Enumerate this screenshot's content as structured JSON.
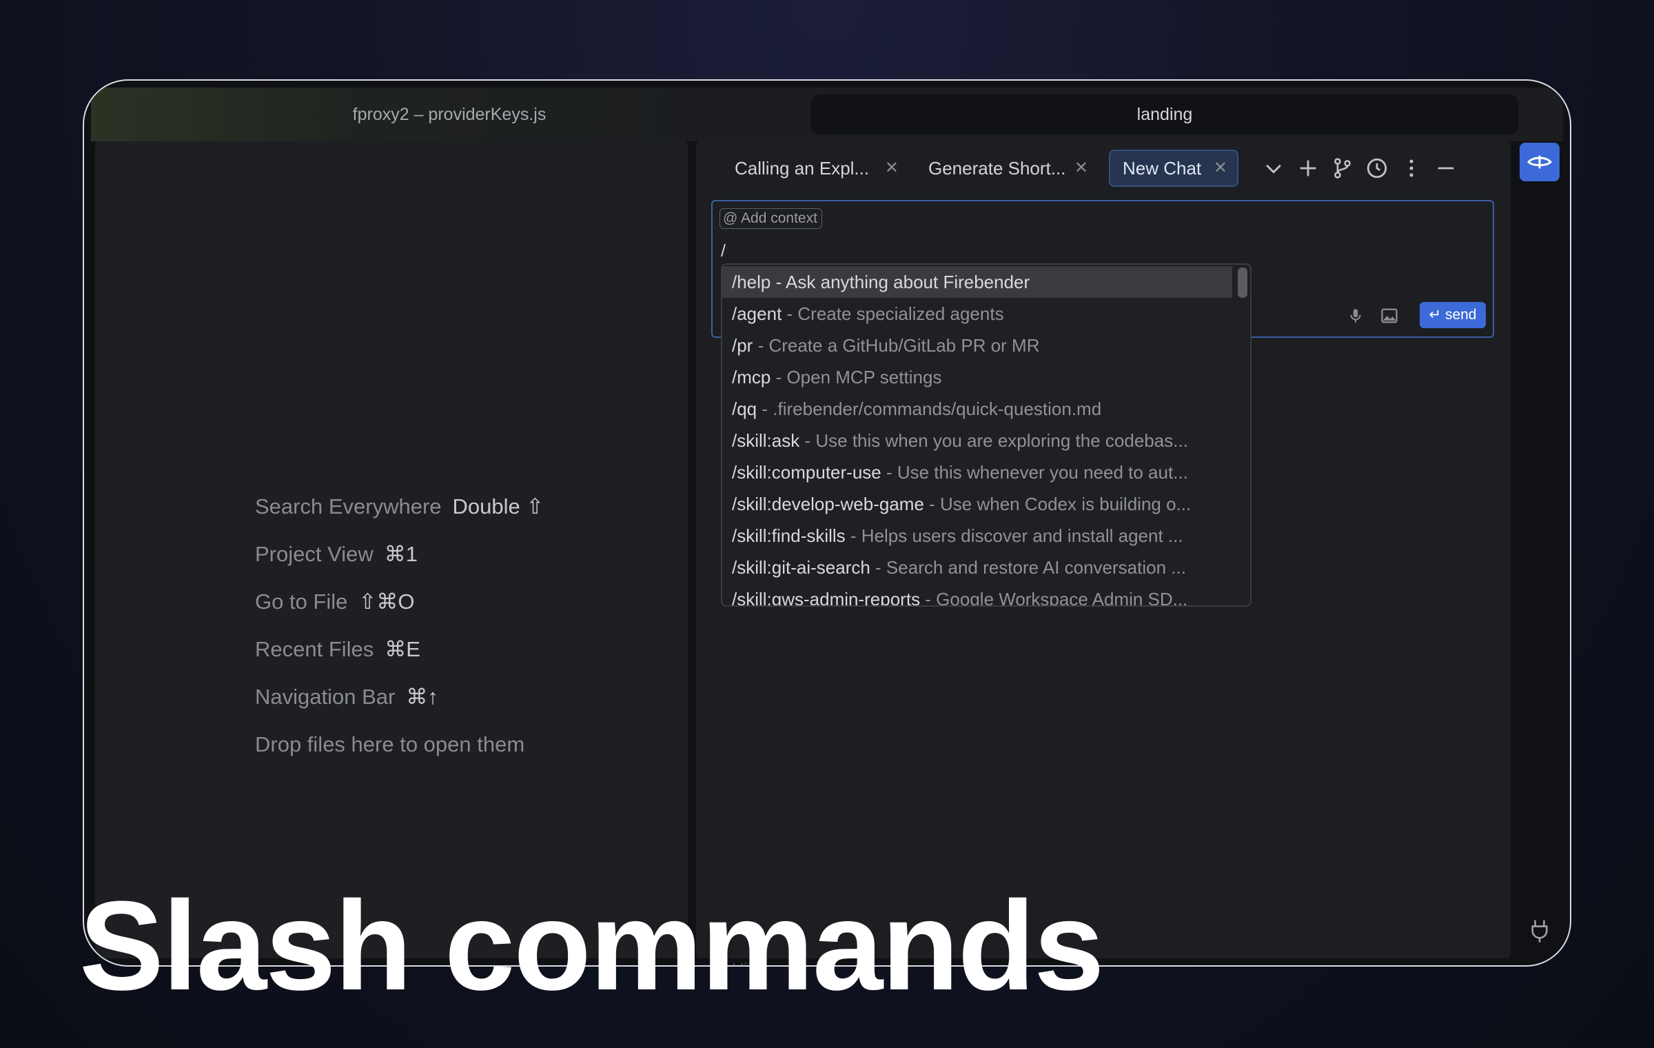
{
  "window": {
    "left_title": "fproxy2 – providerKeys.js",
    "right_title": "landing"
  },
  "welcome": {
    "shortcuts": [
      {
        "label": "Search Everywhere",
        "key": "Double ⇧"
      },
      {
        "label": "Project View",
        "key": "⌘1"
      },
      {
        "label": "Go to File",
        "key": "⇧⌘O"
      },
      {
        "label": "Recent Files",
        "key": "⌘E"
      },
      {
        "label": "Navigation Bar",
        "key": "⌘↑"
      },
      {
        "label": "Drop files here to open them",
        "key": ""
      }
    ]
  },
  "chat": {
    "tabs": [
      {
        "label": "Calling an Expl...",
        "active": false
      },
      {
        "label": "Generate Short...",
        "active": false
      },
      {
        "label": "New Chat",
        "active": true
      }
    ],
    "add_context_label": "Add context",
    "input_value": "/",
    "send_label": "send",
    "history_label": "History >",
    "commands": [
      {
        "cmd": "/help",
        "desc": " - Ask anything about Firebender"
      },
      {
        "cmd": "/agent",
        "desc": " - Create specialized agents"
      },
      {
        "cmd": "/pr",
        "desc": " - Create a GitHub/GitLab PR or MR"
      },
      {
        "cmd": "/mcp",
        "desc": " - Open MCP settings"
      },
      {
        "cmd": "/qq",
        "desc": " - .firebender/commands/quick-question.md"
      },
      {
        "cmd": "/skill:ask",
        "desc": " - Use this when you are exploring the codebas..."
      },
      {
        "cmd": "/skill:computer-use",
        "desc": " - Use this whenever you need to aut..."
      },
      {
        "cmd": "/skill:develop-web-game",
        "desc": " - Use when Codex is building o..."
      },
      {
        "cmd": "/skill:find-skills",
        "desc": " - Helps users discover and install agent ..."
      },
      {
        "cmd": "/skill:git-ai-search",
        "desc": " - Search and restore AI conversation ..."
      },
      {
        "cmd": "/skill:gws-admin-reports",
        "desc": " - Google Workspace Admin SD..."
      }
    ]
  },
  "caption": "Slash commands",
  "colors": {
    "accent": "#3c6ad8",
    "active_tab": "#26344f",
    "input_border": "#3e5ea6"
  }
}
